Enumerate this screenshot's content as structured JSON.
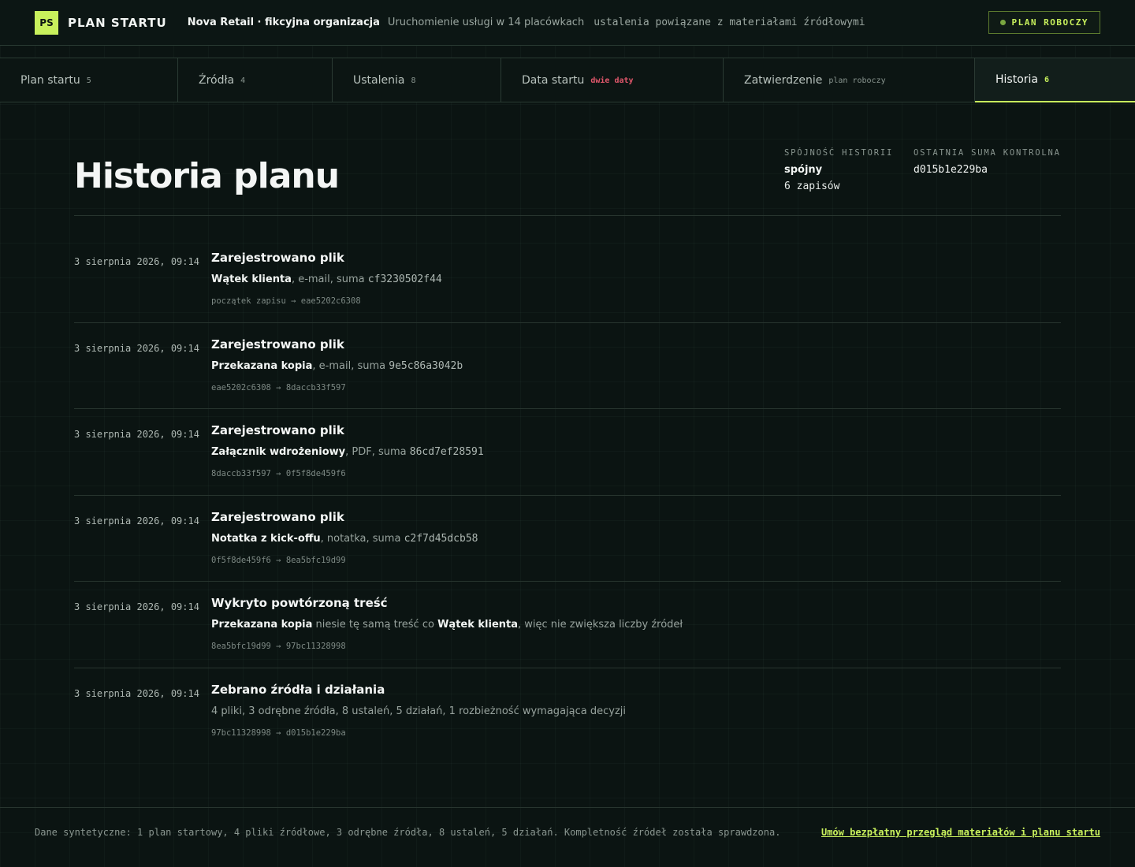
{
  "header": {
    "logo_badge": "PS",
    "logo_text": "PLAN STARTU",
    "organization": "Nova Retail · fikcyjna organizacja",
    "subtitle": "Uruchomienie usługi w 14 placówkach",
    "subtitle_mono": "ustalenia powiązane z materiałami źródłowymi",
    "status": "PLAN ROBOCZY"
  },
  "tabs": [
    {
      "label": "Plan startu",
      "count": "5"
    },
    {
      "label": "Źródła",
      "count": "4"
    },
    {
      "label": "Ustalenia",
      "count": "8"
    },
    {
      "label": "Data startu",
      "count": "dwie daty"
    },
    {
      "label": "Zatwierdzenie",
      "count": "plan roboczy"
    },
    {
      "label": "Historia",
      "count": "6"
    }
  ],
  "main": {
    "title": "Historia planu",
    "consistency_label": "SPÓJNOŚĆ HISTORII",
    "consistency_value": "spójny",
    "consistency_count": "6 zapisów",
    "checksum_label": "OSTATNIA SUMA KONTROLNA",
    "checksum_value": "d015b1e229ba"
  },
  "entries": [
    {
      "date": "3 sierpnia 2026, 09:14",
      "title": "Zarejestrowano plik",
      "name": "Wątek klienta",
      "kind": ", e-mail, suma ",
      "hash": "cf3230502f44",
      "chain": "początek zapisu → eae5202c6308"
    },
    {
      "date": "3 sierpnia 2026, 09:14",
      "title": "Zarejestrowano plik",
      "name": "Przekazana kopia",
      "kind": ", e-mail, suma ",
      "hash": "9e5c86a3042b",
      "chain": "eae5202c6308 → 8daccb33f597"
    },
    {
      "date": "3 sierpnia 2026, 09:14",
      "title": "Zarejestrowano plik",
      "name": "Załącznik wdrożeniowy",
      "kind": ", PDF, suma ",
      "hash": "86cd7ef28591",
      "chain": "8daccb33f597 → 0f5f8de459f6"
    },
    {
      "date": "3 sierpnia 2026, 09:14",
      "title": "Zarejestrowano plik",
      "name": "Notatka z kick-offu",
      "kind": ", notatka, suma ",
      "hash": "c2f7d45dcb58",
      "chain": "0f5f8de459f6 → 8ea5bfc19d99"
    },
    {
      "date": "3 sierpnia 2026, 09:14",
      "title": "Wykryto powtórzoną treść",
      "name": "Przekazana kopia",
      "mid": " niesie tę samą treść co ",
      "name2": "Wątek klienta",
      "tail": ", więc nie zwiększa liczby źródeł",
      "chain": "8ea5bfc19d99 → 97bc11328998"
    },
    {
      "date": "3 sierpnia 2026, 09:14",
      "title": "Zebrano źródła i działania",
      "plain": "4 pliki, 3 odrębne źródła, 8 ustaleń, 5 działań, 1 rozbieżność wymagająca decyzji",
      "chain": "97bc11328998 → d015b1e229ba"
    }
  ],
  "footer": {
    "text": "Dane syntetyczne: 1 plan startowy, 4 pliki źródłowe, 3 odrębne źródła, 8 ustaleń, 5 działań. Kompletność źródeł została sprawdzona.",
    "link": "Umów bezpłatny przegląd materiałów i planu startu"
  }
}
